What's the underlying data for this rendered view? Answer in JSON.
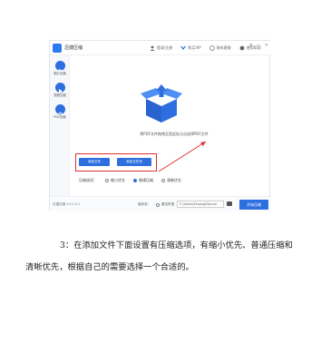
{
  "app": {
    "title": "迅捷压缩",
    "top_links": [
      {
        "label": "登录/注册",
        "icon": "user-icon"
      },
      {
        "label": "购买VIP",
        "icon": "vip-icon"
      },
      {
        "label": "联系客服",
        "icon": "service-icon"
      },
      {
        "label": "使用帮助",
        "icon": "help-icon"
      }
    ],
    "window_controls": [
      "≡",
      "—",
      "×"
    ]
  },
  "sidebar": {
    "items": [
      {
        "label": "图片压缩",
        "icon": "image-icon"
      },
      {
        "label": "视频压缩",
        "icon": "video-icon"
      },
      {
        "label": "PDF压缩",
        "icon": "pdf-icon"
      }
    ]
  },
  "main": {
    "drop_hint": "将PDF文件拖拽至是此处点击选择PDF文件",
    "add_file_button": "添加文件",
    "add_folder_button": "添加文件夹",
    "compress_label": "压缩选项：",
    "compress_options": [
      {
        "label": "缩小优先",
        "selected": false
      },
      {
        "label": "普通压缩",
        "selected": true
      },
      {
        "label": "清晰优先",
        "selected": false
      }
    ]
  },
  "statusbar": {
    "version": "迅捷压缩 V1.0.0.1",
    "output_label": "保存至：",
    "output_option": "原文件夹",
    "path": "C:\\Users\\Xhuang\\Docum",
    "start_button": "开始压缩"
  },
  "colors": {
    "accent": "#2e6fe0",
    "highlight": "#e03030"
  },
  "document": {
    "line1": "3：在添加文件下面设置有压缩选项，有缩小优先、普通压缩和",
    "line2": "清晰优先，根据自己的需要选择一个合适的。"
  }
}
